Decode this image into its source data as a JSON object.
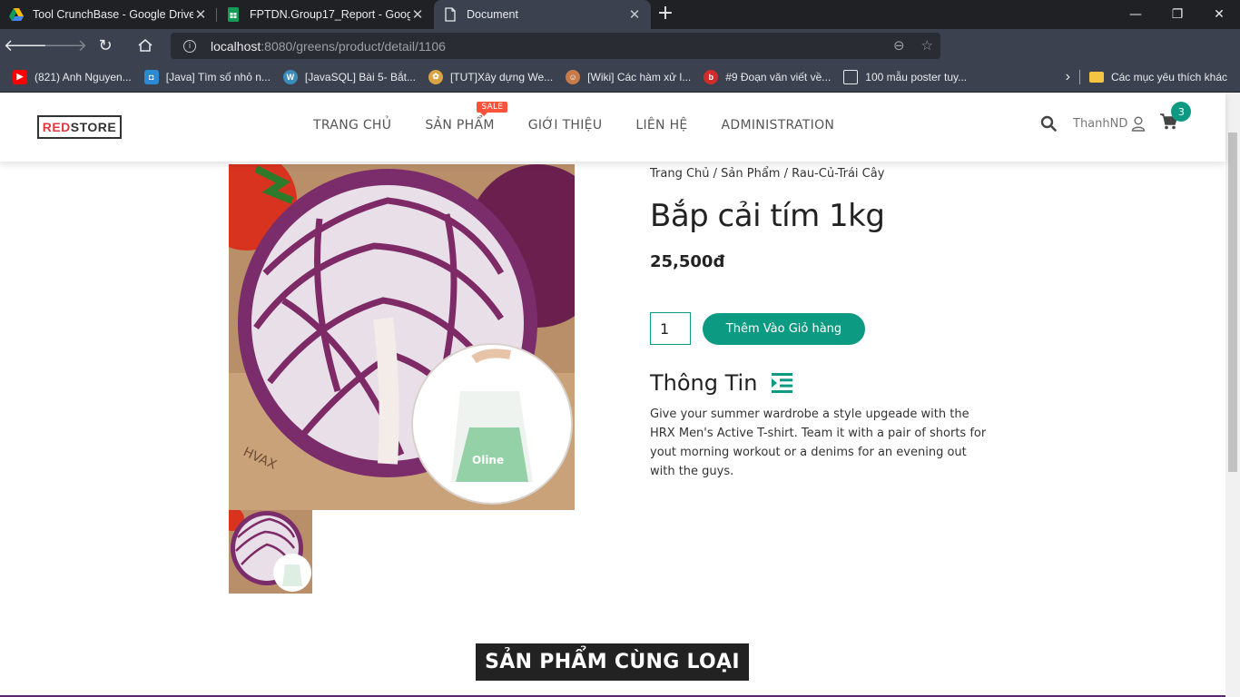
{
  "browser": {
    "tabs": [
      {
        "title": "Tool CrunchBase - Google Drive",
        "icon": "google-drive-icon",
        "active": false
      },
      {
        "title": "FPTDN.Group17_Report - Google",
        "icon": "google-sheets-icon",
        "active": false
      },
      {
        "title": "Document",
        "icon": "document-icon",
        "active": true
      }
    ],
    "url_host": "localhost",
    "url_path": ":8080/greens/product/detail/1106",
    "bookmarks": [
      {
        "label": "(821) Anh Nguyen...",
        "icon": "youtube-icon",
        "color": "#ff0000"
      },
      {
        "label": "[Java] Tìm số nhỏ n...",
        "icon": "codelearn-icon",
        "color": "#2a8ad4"
      },
      {
        "label": "[JavaSQL] Bài 5- Bắt...",
        "icon": "wordpress-icon",
        "color": "#3c8dbc"
      },
      {
        "label": "[TUT]Xây dựng We...",
        "icon": "forum-icon",
        "color": "#d9a441"
      },
      {
        "label": "[Wiki] Các hàm xử l...",
        "icon": "avatar-icon",
        "color": "#c77b4b"
      },
      {
        "label": "#9 Đoạn văn viết về...",
        "icon": "b-icon",
        "color": "#d12b2b"
      },
      {
        "label": "100 mẫu poster tuy...",
        "icon": "file-icon",
        "color": "#5f6368"
      }
    ],
    "other_bookmarks": "Các mục yêu thích khác"
  },
  "site": {
    "logo_red": "RED",
    "logo_dark": "STORE",
    "nav": [
      "TRANG CHỦ",
      "SẢN PHẨM",
      "GIỚI THIỆU",
      "LIÊN HỆ",
      "ADMINISTRATION"
    ],
    "sale_tag": "SALE",
    "username": "ThanhND",
    "cart_count": "3"
  },
  "product": {
    "breadcrumb": "Trang Chủ / Sản Phẩm / Rau-Củ-Trái Cây",
    "name": "Bắp cải tím 1kg",
    "price": "25,500đ",
    "quantity": "1",
    "add_to_cart": "Thêm Vào Giỏ hàng",
    "info_heading": "Thông Tin",
    "description": "Give your summer wardrobe a style upgeade with the HRX Men's Active T-shirt. Team it with a pair of shorts for yout morning workout or a denims for an evening out with the guys.",
    "image_watermark": "HVAX",
    "bag_text": "Oline"
  },
  "related_title": "SẢN PHẨM CÙNG LOẠI",
  "colors": {
    "accent": "#0c9b82",
    "sale": "#ff523b",
    "logo_red": "#e0383e"
  }
}
